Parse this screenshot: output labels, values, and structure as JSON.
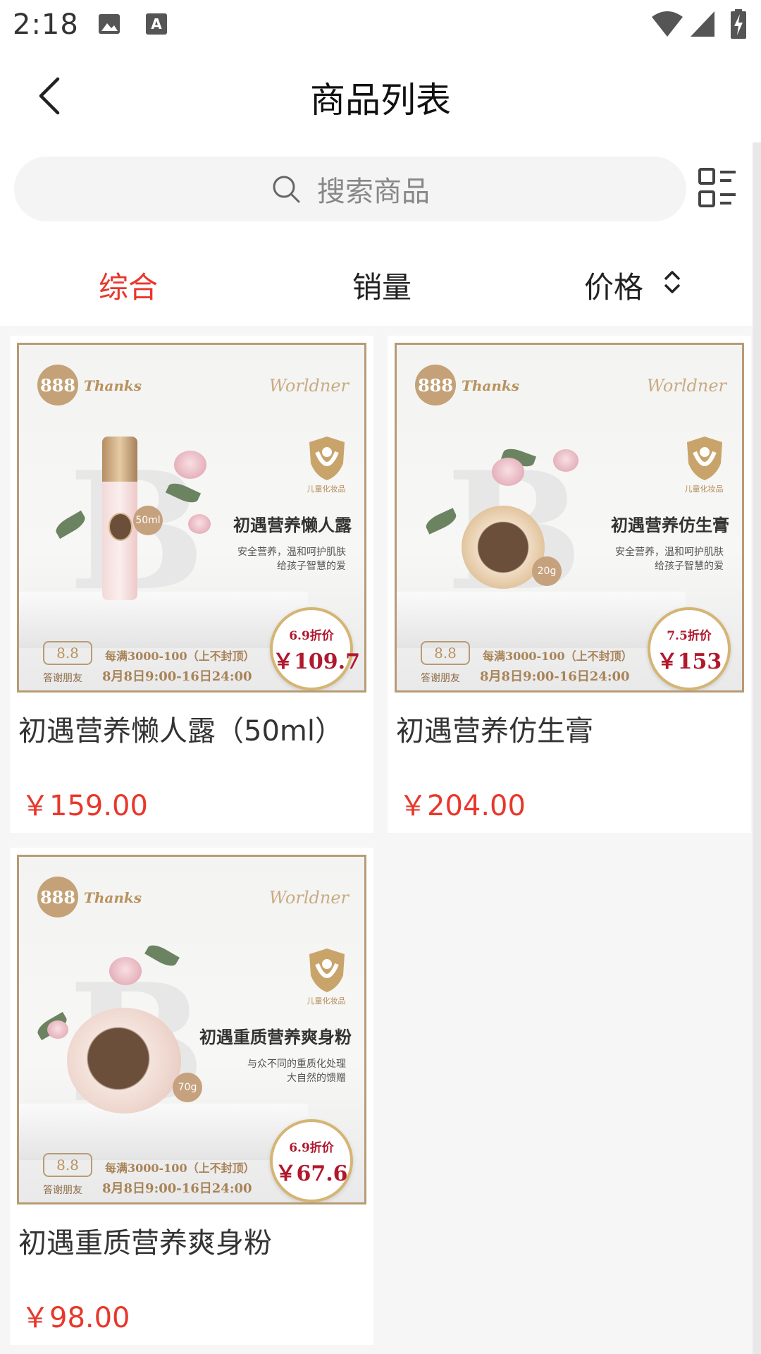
{
  "status_bar": {
    "time": "2:18"
  },
  "nav": {
    "title": "商品列表"
  },
  "search": {
    "placeholder": "搜索商品"
  },
  "sort_tabs": {
    "comprehensive": "综合",
    "sales": "销量",
    "price": "价格"
  },
  "products": [
    {
      "name": "初遇营养懒人露（50ml）",
      "price": "￥159.00",
      "poster": {
        "badge": "888",
        "thanks": "Thanks",
        "brand": "Worldner",
        "shield_label": "儿童化妆品",
        "title": "初遇营养懒人露",
        "sub_line1": "安全营养，温和呵护肌肤",
        "sub_line2": "给孩子智慧的爱",
        "weight": "50ml",
        "promo_box": "8.8",
        "promo_label": "答谢朋友",
        "promo_line1": "每满3000-100（上不封顶）",
        "promo_line2": "8月8日9:00-16日24:00",
        "discount_label": "6.9折价",
        "discount_price": "￥109.7"
      }
    },
    {
      "name": "初遇营养仿生膏",
      "price": "￥204.00",
      "poster": {
        "badge": "888",
        "thanks": "Thanks",
        "brand": "Worldner",
        "shield_label": "儿童化妆品",
        "title": "初遇营养仿生膏",
        "sub_line1": "安全营养，温和呵护肌肤",
        "sub_line2": "给孩子智慧的爱",
        "weight": "20g",
        "promo_box": "8.8",
        "promo_label": "答谢朋友",
        "promo_line1": "每满3000-100（上不封顶）",
        "promo_line2": "8月8日9:00-16日24:00",
        "discount_label": "7.5折价",
        "discount_price": "￥153"
      }
    },
    {
      "name": "初遇重质营养爽身粉",
      "price": "￥98.00",
      "poster": {
        "badge": "888",
        "thanks": "Thanks",
        "brand": "Worldner",
        "shield_label": "儿童化妆品",
        "title": "初遇重质营养爽身粉",
        "sub_line1": "与众不同的重质化处理",
        "sub_line2": "大自然的馈赠",
        "weight": "70g",
        "promo_box": "8.8",
        "promo_label": "答谢朋友",
        "promo_line1": "每满3000-100（上不封顶）",
        "promo_line2": "8月8日9:00-16日24:00",
        "discount_label": "6.9折价",
        "discount_price": "￥67.6"
      }
    }
  ],
  "colors": {
    "accent": "#e8372c",
    "gold": "#b89b74",
    "discount": "#b0182d"
  }
}
